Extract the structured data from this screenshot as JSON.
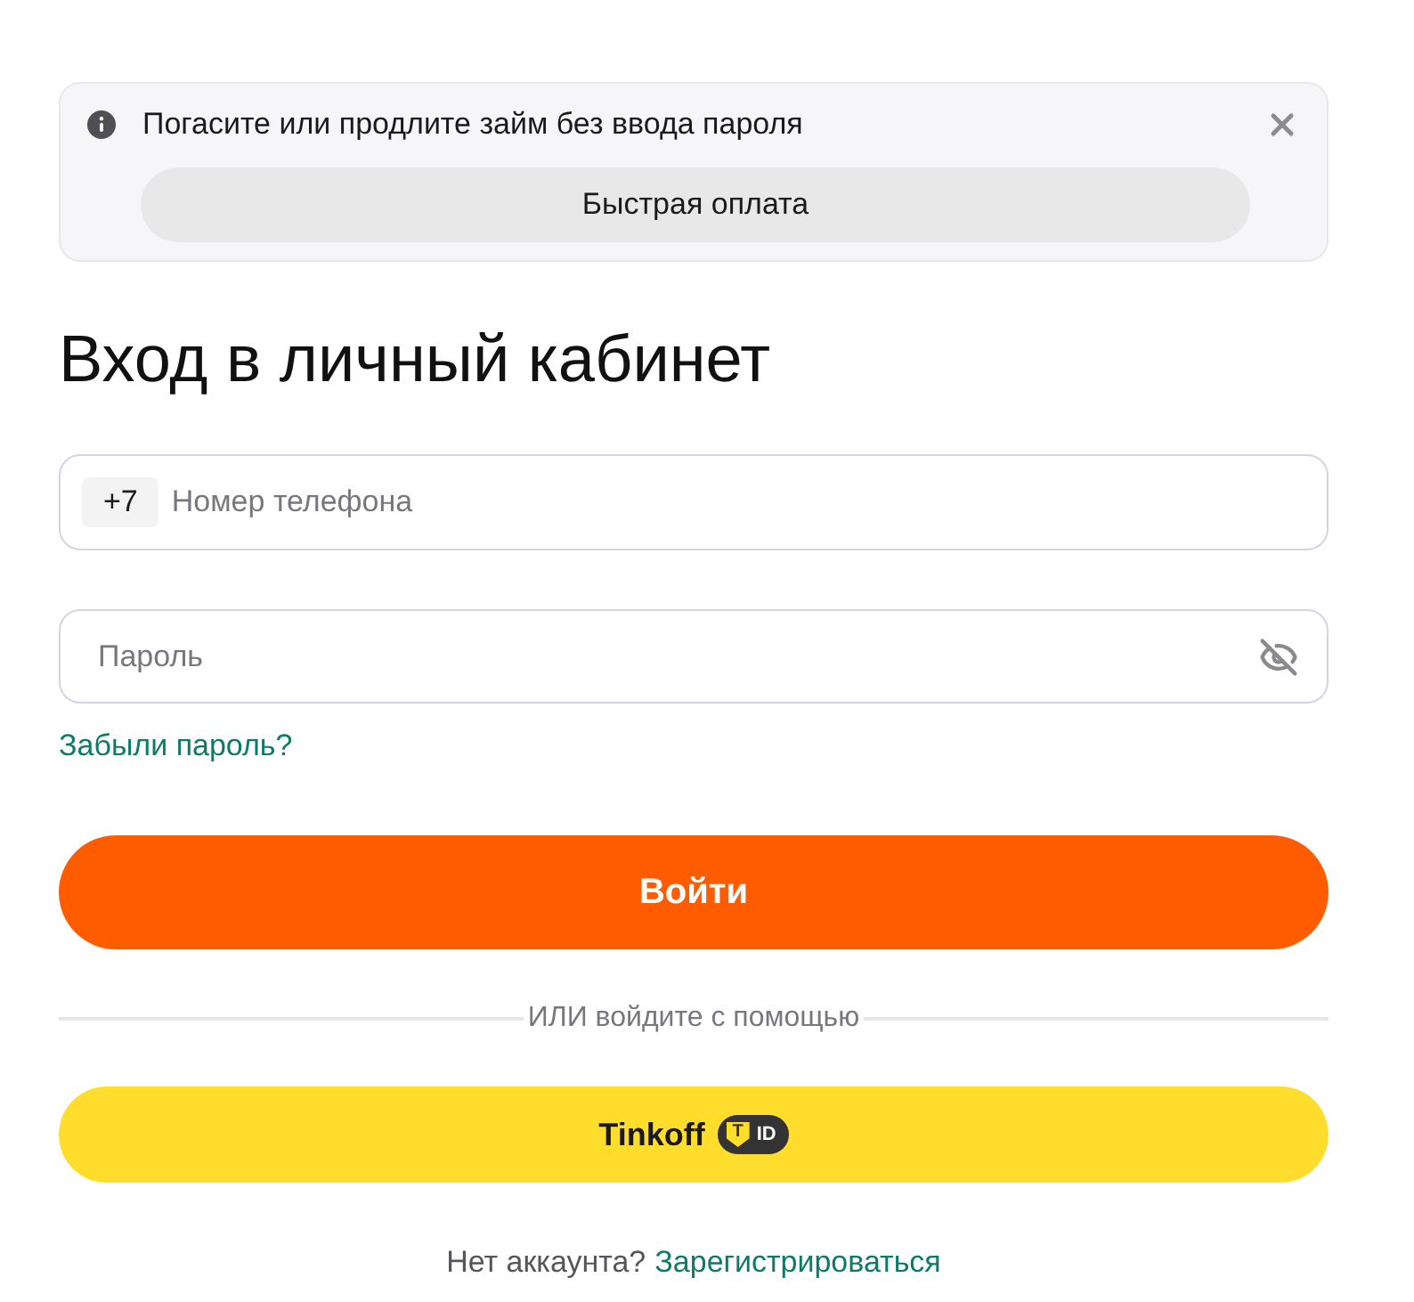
{
  "notice": {
    "text": "Погасите или продлите займ без ввода пароля",
    "button": "Быстрая оплата"
  },
  "title": "Вход в личный кабинет",
  "phone": {
    "prefix": "+7",
    "placeholder": "Номер телефона"
  },
  "password": {
    "placeholder": "Пароль"
  },
  "forgot_link": "Забыли пароль?",
  "submit": "Войти",
  "divider": "ИЛИ войдите с помощью",
  "tinkoff": {
    "label": "Tinkoff",
    "badge_mark": "T",
    "badge_label": "ID"
  },
  "signup": {
    "text": "Нет аккаунта?",
    "link": "Зарегистрироваться"
  }
}
